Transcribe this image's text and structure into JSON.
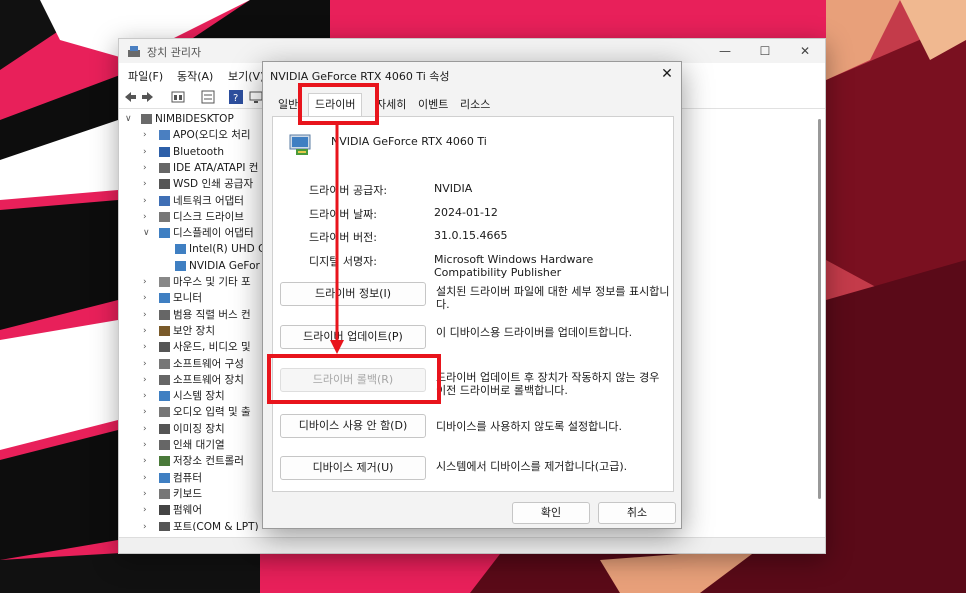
{
  "device_manager": {
    "title": "장치 관리자",
    "menu": [
      "파일(F)",
      "동작(A)",
      "보기(V)"
    ],
    "window_controls": {
      "minimize": "—",
      "maximize": "☐",
      "close": "✕"
    },
    "tree": [
      {
        "label": "NIMBIDESKTOP",
        "level": 0,
        "chevron": "∨"
      },
      {
        "label": "APO(오디오 처리",
        "level": 1,
        "chevron": "›"
      },
      {
        "label": "Bluetooth",
        "level": 1,
        "chevron": "›"
      },
      {
        "label": "IDE ATA/ATAPI 컨",
        "level": 1,
        "chevron": "›"
      },
      {
        "label": "WSD 인쇄 공급자",
        "level": 1,
        "chevron": "›"
      },
      {
        "label": "네트워크 어댑터",
        "level": 1,
        "chevron": "›"
      },
      {
        "label": "디스크 드라이브",
        "level": 1,
        "chevron": "›"
      },
      {
        "label": "디스플레이 어댑터",
        "level": 1,
        "chevron": "∨"
      },
      {
        "label": "Intel(R) UHD G",
        "level": 2,
        "chevron": ""
      },
      {
        "label": "NVIDIA GeFor",
        "level": 2,
        "chevron": ""
      },
      {
        "label": "마우스 및 기타 포",
        "level": 1,
        "chevron": "›"
      },
      {
        "label": "모니터",
        "level": 1,
        "chevron": "›"
      },
      {
        "label": "범용 직렬 버스 컨",
        "level": 1,
        "chevron": "›"
      },
      {
        "label": "보안 장치",
        "level": 1,
        "chevron": "›"
      },
      {
        "label": "사운드, 비디오 및",
        "level": 1,
        "chevron": "›"
      },
      {
        "label": "소프트웨어 구성",
        "level": 1,
        "chevron": "›"
      },
      {
        "label": "소프트웨어 장치",
        "level": 1,
        "chevron": "›"
      },
      {
        "label": "시스템 장치",
        "level": 1,
        "chevron": "›"
      },
      {
        "label": "오디오 입력 및 출",
        "level": 1,
        "chevron": "›"
      },
      {
        "label": "이미징 장치",
        "level": 1,
        "chevron": "›"
      },
      {
        "label": "인쇄 대기열",
        "level": 1,
        "chevron": "›"
      },
      {
        "label": "저장소 컨트롤러",
        "level": 1,
        "chevron": "›"
      },
      {
        "label": "컴퓨터",
        "level": 1,
        "chevron": "›"
      },
      {
        "label": "키보드",
        "level": 1,
        "chevron": "›"
      },
      {
        "label": "펌웨어",
        "level": 1,
        "chevron": "›"
      },
      {
        "label": "포트(COM & LPT)",
        "level": 1,
        "chevron": "›"
      }
    ]
  },
  "dialog": {
    "title": "NVIDIA GeForce RTX 4060 Ti 속성",
    "close": "✕",
    "tabs": [
      "일반",
      "드라이버",
      "자세히",
      "이벤트",
      "리소스"
    ],
    "active_tab": "드라이버",
    "device_name": "NVIDIA GeForce RTX 4060 Ti",
    "info": [
      {
        "label": "드라이버 공급자:",
        "value": "NVIDIA"
      },
      {
        "label": "드라이버 날짜:",
        "value": "2024-01-12"
      },
      {
        "label": "드라이버 버전:",
        "value": "31.0.15.4665"
      },
      {
        "label": "디지털 서명자:",
        "value": "Microsoft Windows Hardware Compatibility Publisher"
      }
    ],
    "actions": [
      {
        "label": "드라이버 정보(I)",
        "desc": "설치된 드라이버 파일에 대한 세부 정보를 표시합니다.",
        "enabled": true
      },
      {
        "label": "드라이버 업데이트(P)",
        "desc": "이 디바이스용 드라이버를 업데이트합니다.",
        "enabled": true
      },
      {
        "label": "드라이버 롤백(R)",
        "desc": "드라이버 업데이트 후 장치가 작동하지 않는 경우 이전 드라이버로 롤백합니다.",
        "enabled": false
      },
      {
        "label": "디바이스 사용 안 함(D)",
        "desc": "디바이스를 사용하지 않도록 설정합니다.",
        "enabled": true
      },
      {
        "label": "디바이스 제거(U)",
        "desc": "시스템에서 디바이스를 제거합니다(고급).",
        "enabled": true
      }
    ],
    "ok_label": "확인",
    "cancel_label": "취소"
  },
  "colors": {
    "highlight": "#e8141c",
    "background": "#e8205a",
    "dialog_bg": "#f3f3f3",
    "disabled_text": "#a6a6a6"
  }
}
